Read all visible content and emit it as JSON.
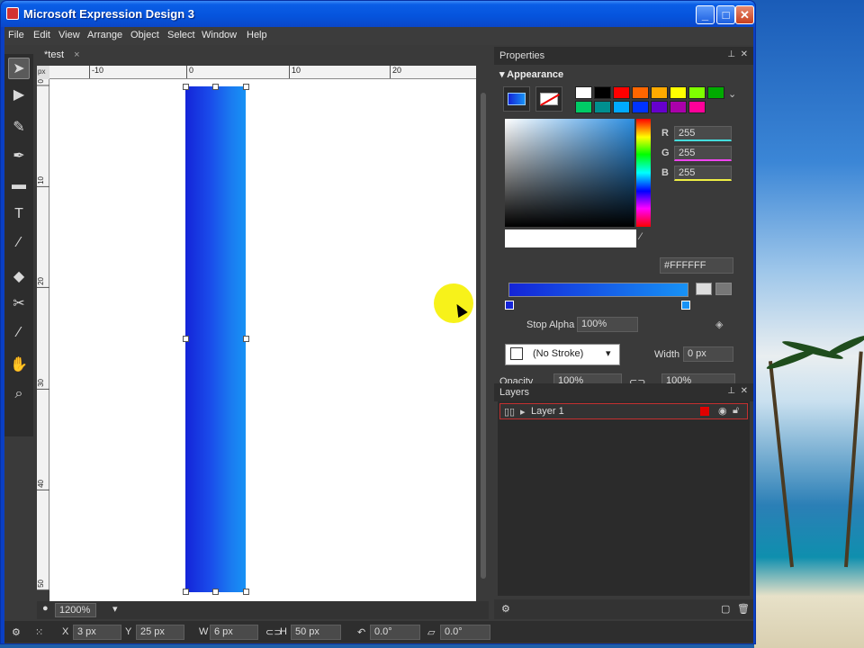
{
  "window": {
    "title": "Microsoft Expression Design 3"
  },
  "window_controls": {
    "minimize": "_",
    "maximize": "□",
    "close": "✕"
  },
  "menu": [
    "File",
    "Edit",
    "View",
    "Arrange",
    "Object",
    "Select",
    "Window",
    "Help"
  ],
  "document": {
    "tab_label": "*test",
    "tab_close": "×",
    "zoom": "1200%"
  },
  "ruler": {
    "corner": "px",
    "top_ticks": [
      "-10",
      "0",
      "10",
      "20"
    ],
    "left_ticks": [
      "0",
      "10",
      "20",
      "30",
      "40",
      "50"
    ]
  },
  "tools": [
    "selection-icon",
    "direct-selection-icon",
    "paintbrush-icon",
    "pen-icon",
    "rectangle-icon",
    "text-icon",
    "eyedropper-icon",
    "eraser-icon",
    "scissors-icon",
    "color-picker-icon",
    "hand-icon",
    "zoom-icon"
  ],
  "properties": {
    "header": "Properties",
    "appearance_label": "Appearance",
    "rgb": {
      "r_label": "R",
      "r": "255",
      "g_label": "G",
      "g": "255",
      "b_label": "B",
      "b": "255"
    },
    "hex": "#FFFFFF",
    "stop_alpha_label": "Stop Alpha",
    "stop_alpha": "100%",
    "stroke": "(No Stroke)",
    "width_label": "Width",
    "width": "0 px",
    "opacity_label": "Opacity",
    "opacity": "100%",
    "opacity2": "100%",
    "swatches": [
      "#ffffff",
      "#000000",
      "#ff0000",
      "#ff6600",
      "#ffaa00",
      "#ffff00",
      "#7fff00",
      "#00aa00",
      "#00cc66",
      "#008f8f",
      "#00aaff",
      "#0033ff",
      "#6600cc",
      "#aa00aa",
      "#ff0099"
    ]
  },
  "layers": {
    "header": "Layers",
    "items": [
      {
        "name": "Layer 1",
        "color": "#e00000"
      }
    ]
  },
  "status": {
    "x_label": "X",
    "x": "3 px",
    "y_label": "Y",
    "y": "25 px",
    "w_label": "W",
    "w": "6 px",
    "h_label": "H",
    "h": "50 px",
    "rotation": "0.0°",
    "skew": "0.0°"
  }
}
